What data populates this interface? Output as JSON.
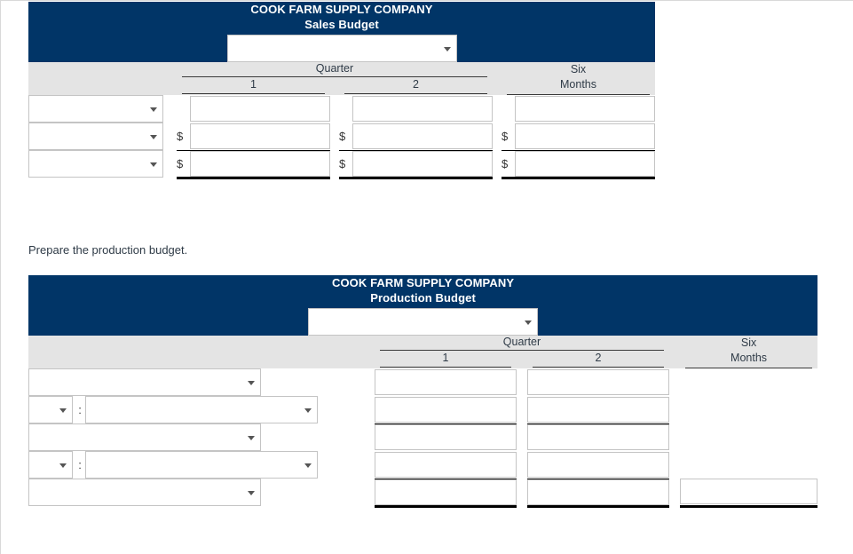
{
  "company": "COOK FARM SUPPLY COMPANY",
  "instruction": "Prepare the production budget.",
  "columns": {
    "quarter_group": "Quarter",
    "q1": "1",
    "q2": "2",
    "six_line1": "Six",
    "six_line2": "Months"
  },
  "symbols": {
    "dollar": "$",
    "colon": ":",
    "caret": "caret-down-icon"
  },
  "colors": {
    "navy": "#013567",
    "header_gray": "#e4e4e4",
    "rule": "#3a3a3a",
    "input_border": "#c4c4c4"
  },
  "sales_budget": {
    "title_line1": "COOK FARM SUPPLY COMPANY",
    "title_line2": "Sales Budget",
    "period_select": {
      "value": "",
      "placeholder": ""
    },
    "rows": [
      {
        "label_select": {
          "value": ""
        },
        "show_dollar": false,
        "q1": {
          "value": ""
        },
        "q2": {
          "value": ""
        },
        "six": {
          "value": ""
        },
        "underline": "none"
      },
      {
        "label_select": {
          "value": ""
        },
        "show_dollar": true,
        "q1": {
          "value": ""
        },
        "q2": {
          "value": ""
        },
        "six": {
          "value": ""
        },
        "underline": "thin"
      },
      {
        "label_select": {
          "value": ""
        },
        "show_dollar": true,
        "q1": {
          "value": ""
        },
        "q2": {
          "value": ""
        },
        "six": {
          "value": ""
        },
        "underline": "thick"
      }
    ]
  },
  "production_budget": {
    "title_line1": "COOK FARM SUPPLY COMPANY",
    "title_line2": "Production Budget",
    "period_select": {
      "value": "",
      "placeholder": ""
    },
    "rows": [
      {
        "type": "single",
        "label_select": {
          "value": ""
        },
        "q1": {
          "value": ""
        },
        "q2": {
          "value": ""
        },
        "six": null,
        "underline": "none"
      },
      {
        "type": "prefixed",
        "prefix_select": {
          "value": ""
        },
        "separator": ":",
        "label_select": {
          "value": ""
        },
        "q1": {
          "value": ""
        },
        "q2": {
          "value": ""
        },
        "six": null,
        "underline": "thin"
      },
      {
        "type": "single",
        "label_select": {
          "value": ""
        },
        "q1": {
          "value": ""
        },
        "q2": {
          "value": ""
        },
        "six": null,
        "underline": "none"
      },
      {
        "type": "prefixed",
        "prefix_select": {
          "value": ""
        },
        "separator": ":",
        "label_select": {
          "value": ""
        },
        "q1": {
          "value": ""
        },
        "q2": {
          "value": ""
        },
        "six": null,
        "underline": "thin"
      },
      {
        "type": "single",
        "label_select": {
          "value": ""
        },
        "q1": {
          "value": ""
        },
        "q2": {
          "value": ""
        },
        "six": {
          "value": ""
        },
        "underline": "thick"
      }
    ]
  }
}
